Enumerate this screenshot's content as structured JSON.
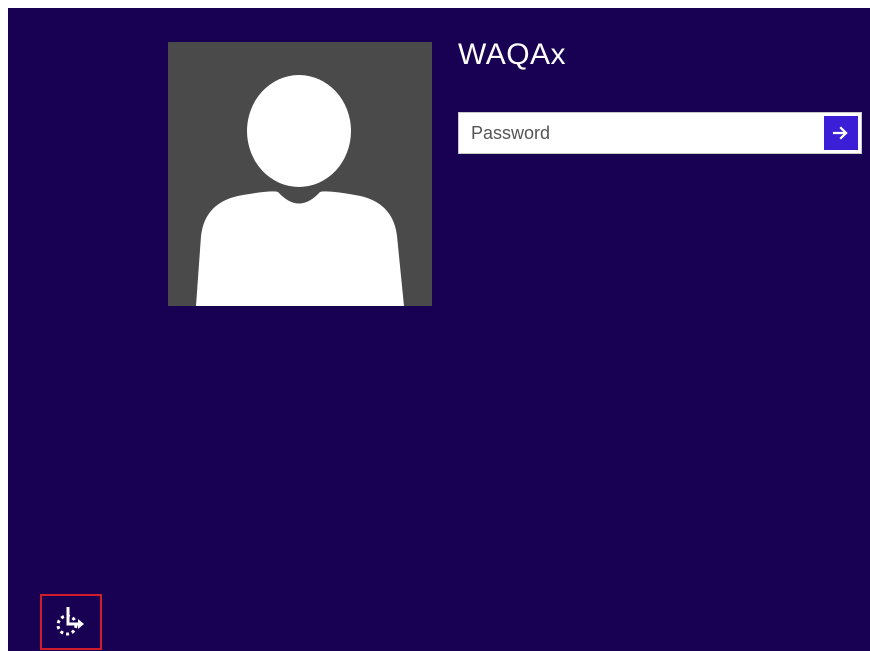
{
  "lock_screen": {
    "background_color": "#180052",
    "user": {
      "name": "WAQAx",
      "avatar_icon": "default-user-avatar-icon"
    },
    "password": {
      "placeholder": "Password",
      "value": "",
      "submit_icon": "arrow-right-icon",
      "submit_color": "#3a1fd6"
    },
    "ease_of_access": {
      "icon": "ease-of-access-icon",
      "highlight_color": "#d11a2a"
    }
  }
}
